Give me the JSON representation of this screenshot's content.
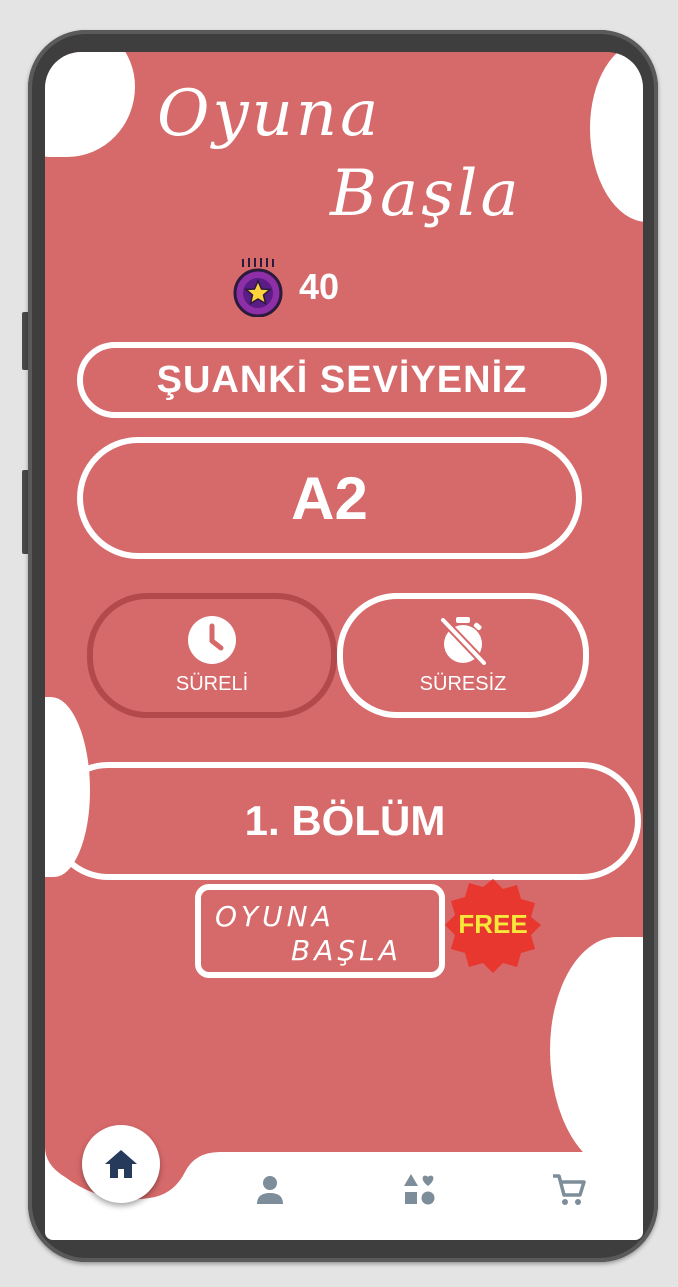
{
  "header": {
    "title_line1": "Oyuna",
    "title_line2": "Başla"
  },
  "coins": {
    "count": "40",
    "icon": "star-coin-icon"
  },
  "level": {
    "label": "ŞUANKİ SEVİYENİZ",
    "value": "A2"
  },
  "modes": [
    {
      "label": "SÜRELİ",
      "icon": "clock-icon",
      "selected": true
    },
    {
      "label": "SÜRESİZ",
      "icon": "timer-off-icon",
      "selected": false
    }
  ],
  "chapter": {
    "label": "1. BÖLÜM"
  },
  "start_button": {
    "line1": "OYUNA",
    "line2": "BAŞLA",
    "badge": "FREE"
  },
  "bottom_nav": [
    {
      "name": "home",
      "icon": "home-icon",
      "active": true
    },
    {
      "name": "profile",
      "icon": "user-icon",
      "active": false
    },
    {
      "name": "categories",
      "icon": "shapes-icon",
      "active": false
    },
    {
      "name": "shop",
      "icon": "cart-icon",
      "active": false
    }
  ],
  "colors": {
    "background": "#d6696a",
    "selected_border": "#b3494b",
    "nav_icon": "#7d8d99",
    "home_icon": "#263a5c",
    "badge": "#e8372f",
    "badge_text": "#f7e73a"
  }
}
